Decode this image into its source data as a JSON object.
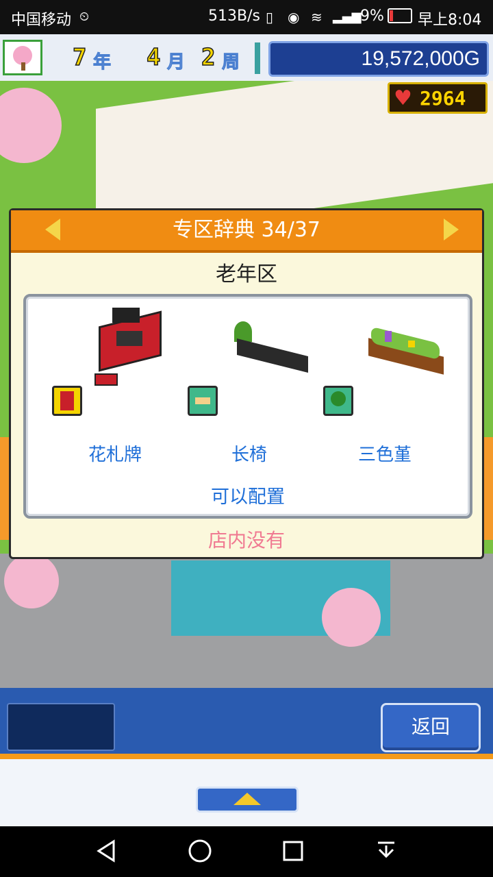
{
  "status_bar": {
    "carrier": "中国移动",
    "speed": "513B/s",
    "battery": "9%",
    "time": "早上8:04"
  },
  "hud": {
    "year_num": "7",
    "year_unit": "年",
    "month_num": "4",
    "month_unit": "月",
    "week_num": "2",
    "week_unit": "周",
    "money": "19,572,000G",
    "hearts": "2964"
  },
  "dialog": {
    "title": "专区辞典 34/37",
    "zone_name": "老年区",
    "items": [
      {
        "label": "花札牌",
        "icon": "arcade-cabinet-icon",
        "category_icon": "machine-category-icon"
      },
      {
        "label": "长椅",
        "icon": "bench-icon",
        "category_icon": "bench-category-icon"
      },
      {
        "label": "三色堇",
        "icon": "flower-planter-icon",
        "category_icon": "tree-category-icon"
      }
    ],
    "placeable_text": "可以配置",
    "status_text": "店内没有"
  },
  "bottom": {
    "back_label": "返回"
  },
  "colors": {
    "dialog_header": "#f08c12",
    "item_label": "#1f6fd8",
    "status_text": "#f07a92",
    "money_bg": "#1d3f92"
  }
}
